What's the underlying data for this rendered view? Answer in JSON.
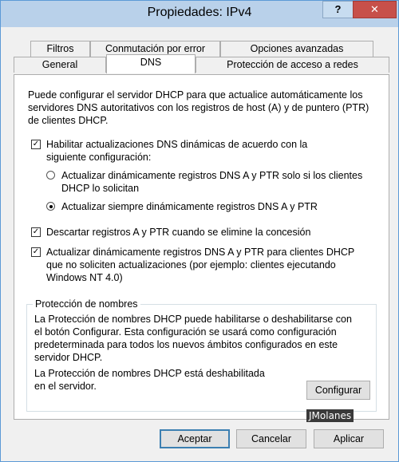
{
  "window": {
    "title": "Propiedades: IPv4",
    "help_label": "?",
    "close_label": "✕"
  },
  "tabs": {
    "row1": [
      {
        "label": "Filtros"
      },
      {
        "label": "Conmutación por error"
      },
      {
        "label": "Opciones avanzadas"
      }
    ],
    "row2": [
      {
        "label": "General"
      },
      {
        "label": "DNS"
      },
      {
        "label": "Protección de acceso a redes"
      }
    ],
    "active": "DNS"
  },
  "dns": {
    "intro": "Puede configurar el servidor DHCP para que actualice automáticamente los servidores DNS autoritativos con los registros de host (A) y de puntero (PTR) de clientes DHCP.",
    "enable_dynamic": {
      "checked": true,
      "label_line1": "Habilitar actualizaciones DNS dinámicas de acuerdo con la",
      "label_line2": "siguiente configuración:"
    },
    "radio_on_request": {
      "selected": false,
      "label_line1": "Actualizar dinámicamente registros DNS A y PTR solo si los clientes",
      "label_line2": "DHCP lo solicitan"
    },
    "radio_always": {
      "selected": true,
      "label": "Actualizar siempre dinámicamente registros DNS A y PTR"
    },
    "discard_on_delete": {
      "checked": true,
      "label": "Descartar registros A y PTR cuando se elimine la concesión"
    },
    "update_non_requesting": {
      "checked": true,
      "label_line1": "Actualizar dinámicamente registros DNS A y PTR para clientes DHCP",
      "label_line2": "que no soliciten actualizaciones (por ejemplo: clientes ejecutando",
      "label_line3": "Windows NT 4.0)"
    },
    "name_protection": {
      "title": "Protección de nombres",
      "description_line1": "La Protección de nombres DHCP puede habilitarse o deshabilitarse con",
      "description_line2": "el botón Configurar. Esta configuración se usará como configuración",
      "description_line3": "predeterminada para todos los nuevos ámbitos configurados en este",
      "description_line4": "servidor DHCP.",
      "status_line1": "La Protección de nombres DHCP está deshabilitada",
      "status_line2": "en el servidor.",
      "configure_label": "Configurar"
    }
  },
  "footer": {
    "accept_label": "Aceptar",
    "cancel_label": "Cancelar",
    "apply_label": "Aplicar"
  },
  "watermark": "JMolanes"
}
